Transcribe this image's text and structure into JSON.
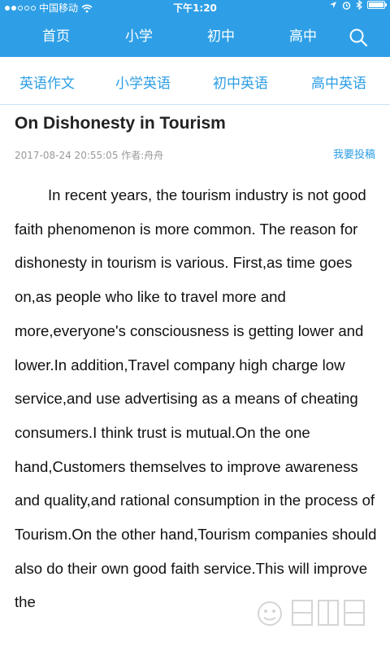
{
  "status_bar": {
    "carrier": "中国移动",
    "time": "下午1:20",
    "signal_dots": 5,
    "signal_filled": 2,
    "battery_level": 0.9
  },
  "top_nav": {
    "items": [
      {
        "label": "首页"
      },
      {
        "label": "小学"
      },
      {
        "label": "初中"
      },
      {
        "label": "高中"
      }
    ],
    "search_icon": "search-icon"
  },
  "sub_nav": {
    "items": [
      {
        "label": "英语作文"
      },
      {
        "label": "小学英语"
      },
      {
        "label": "初中英语"
      },
      {
        "label": "高中英语"
      }
    ]
  },
  "article": {
    "title": "On Dishonesty in Tourism",
    "meta": "2017-08-24 20:55:05 作者:舟舟",
    "submit_label": "我要投稿",
    "body": "In recent years, the tourism industry is not good faith phenomenon is more common. The reason for dishonesty in tourism is various. First,as time goes on,as people who like to travel more and more,everyone's consciousness is getting lower and lower.In addition,Travel company high charge low service,and use advertising as a means of cheating consumers.I think trust is mutual.On the one hand,Customers themselves to improve awareness and quality,and rational consumption in the process of Tourism.On the other hand,Tourism companies should also do their own good faith service.This will improve the"
  },
  "colors": {
    "brand_blue": "#2e9fe6",
    "link_blue": "#2d9ee4",
    "meta_gray": "#9a9a9a",
    "text": "#111111"
  }
}
